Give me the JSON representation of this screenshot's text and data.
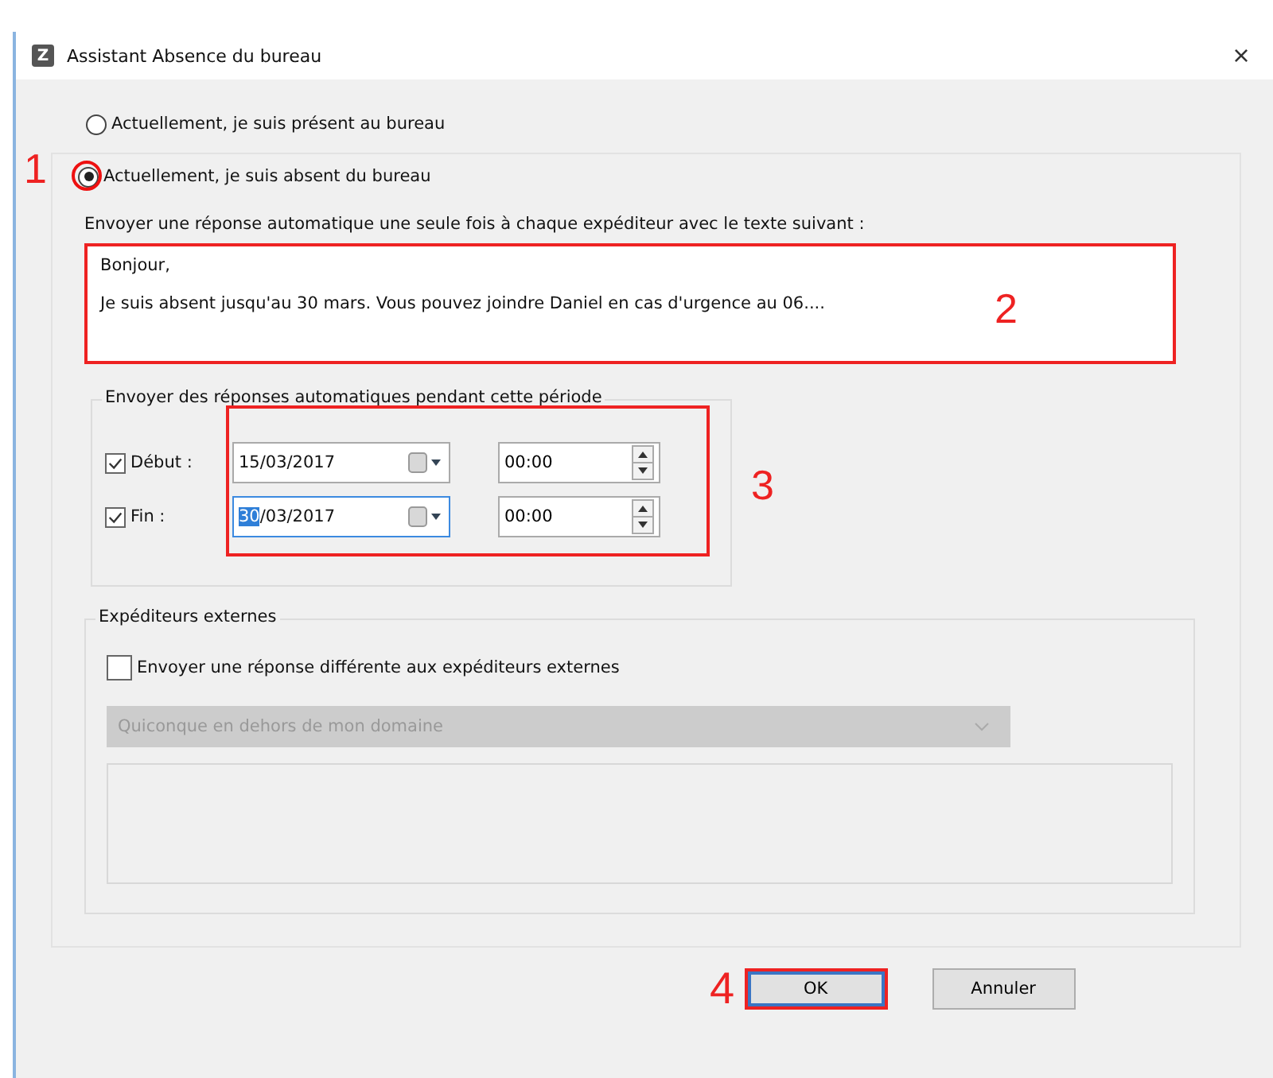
{
  "window": {
    "title": "Assistant Absence du bureau",
    "close": "×",
    "app_letter": "Z"
  },
  "status_options": [
    {
      "label": "Actuellement, je suis présent au bureau",
      "selected": false
    },
    {
      "label": "Actuellement, je suis absent du bureau",
      "selected": true
    }
  ],
  "reply_label": "Envoyer une réponse automatique une seule fois à chaque expéditeur avec le texte suivant :",
  "reply_text": [
    "Bonjour,",
    "Je suis absent jusqu'au 30 mars. Vous pouvez joindre Daniel en cas d'urgence au 06...."
  ],
  "period": {
    "title": "Envoyer des réponses automatiques pendant cette période",
    "rows": [
      {
        "label": "Début :",
        "checked": true,
        "date_parts": [
          {
            "text": "15/03/2017",
            "selected": false
          }
        ],
        "focused": false,
        "time": "00:00"
      },
      {
        "label": "Fin :",
        "checked": true,
        "date_parts": [
          {
            "text": "30",
            "selected": true
          },
          {
            "text": "/03/2017",
            "selected": false
          }
        ],
        "focused": true,
        "time": "00:00"
      }
    ]
  },
  "external": {
    "title": "Expéditeurs externes",
    "checkbox": {
      "label": "Envoyer une réponse différente aux expéditeurs externes",
      "checked": false
    },
    "audience": {
      "value": "Quiconque en dehors de mon domaine",
      "disabled": true
    }
  },
  "buttons": [
    {
      "label": "OK",
      "default": true
    },
    {
      "label": "Annuler",
      "default": false
    }
  ],
  "annotations": [
    "1",
    "2",
    "3",
    "4"
  ]
}
